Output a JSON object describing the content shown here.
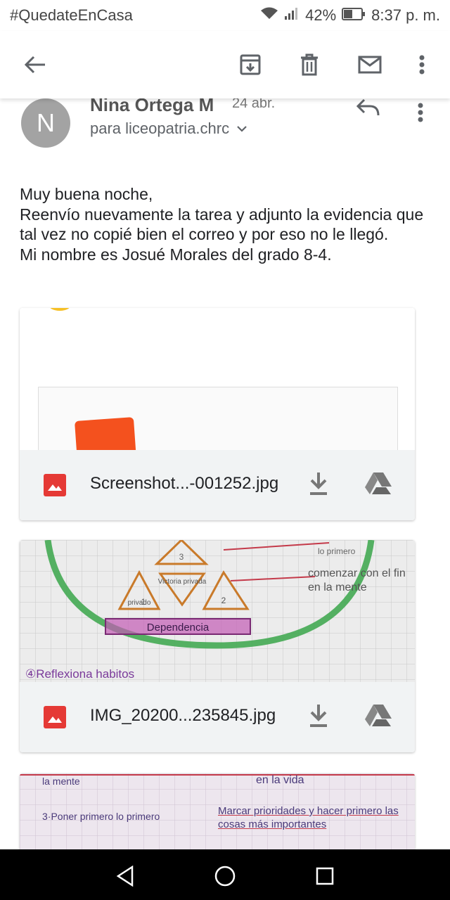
{
  "status_bar": {
    "hashtag": "#QuedateEnCasa",
    "battery": "42%",
    "time": "8:37 p. m."
  },
  "message": {
    "sender_name": "Nina Ortega M",
    "date": "24 abr.",
    "avatar_letter": "N",
    "recipient": "para liceopatria.chrc",
    "body": [
      "Muy buena noche,",
      "Reenvío nuevamente la tarea y adjunto la evidencia que tal vez no copié bien el correo y por eso no le llegó.",
      "Mi nombre es Josué Morales del grado 8-4."
    ]
  },
  "attachments": [
    {
      "filename": "Screenshot...-001252.jpg"
    },
    {
      "filename": "IMG_20200...235845.jpg",
      "handwriting": [
        "3",
        "Victoria privada",
        "1",
        "2",
        "Dependencia",
        "comenzar con el fin en la mente",
        "lo primero",
        "④Reflexiona habitos",
        "privado"
      ]
    },
    {
      "filename": "",
      "handwriting": [
        "la mente",
        "en la vida",
        "3·Poner primero lo primero",
        "Marcar prioridades y hacer primero las cosas más importantes"
      ]
    }
  ],
  "colors": {
    "accent_red": "#e53935",
    "nav_bar": "#000000",
    "attachment_bar": "#f1f3f4"
  }
}
